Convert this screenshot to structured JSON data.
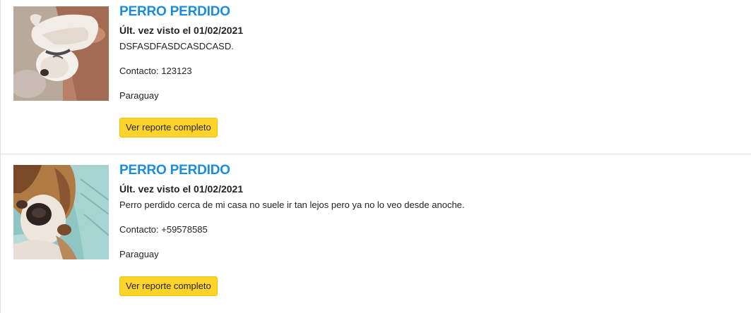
{
  "listings": [
    {
      "title": "PERRO PERDIDO",
      "last_seen": "Últ. vez visto el 01/02/2021",
      "description": "DSFASDFASDCASDCASD.",
      "contact": "Contacto: 123123",
      "country": "Paraguay",
      "button_label": "Ver reporte completo"
    },
    {
      "title": "PERRO PERDIDO",
      "last_seen": "Últ. vez visto el 01/02/2021",
      "description": "Perro perdido cerca de mi casa no suele ir tan lejos pero ya no lo veo desde anoche.",
      "contact": "Contacto: +59578585",
      "country": "Paraguay",
      "button_label": "Ver reporte completo"
    }
  ],
  "colors": {
    "title": "#1a8ce0",
    "button_bg": "#ffd42a",
    "divider": "#dee2e6"
  }
}
